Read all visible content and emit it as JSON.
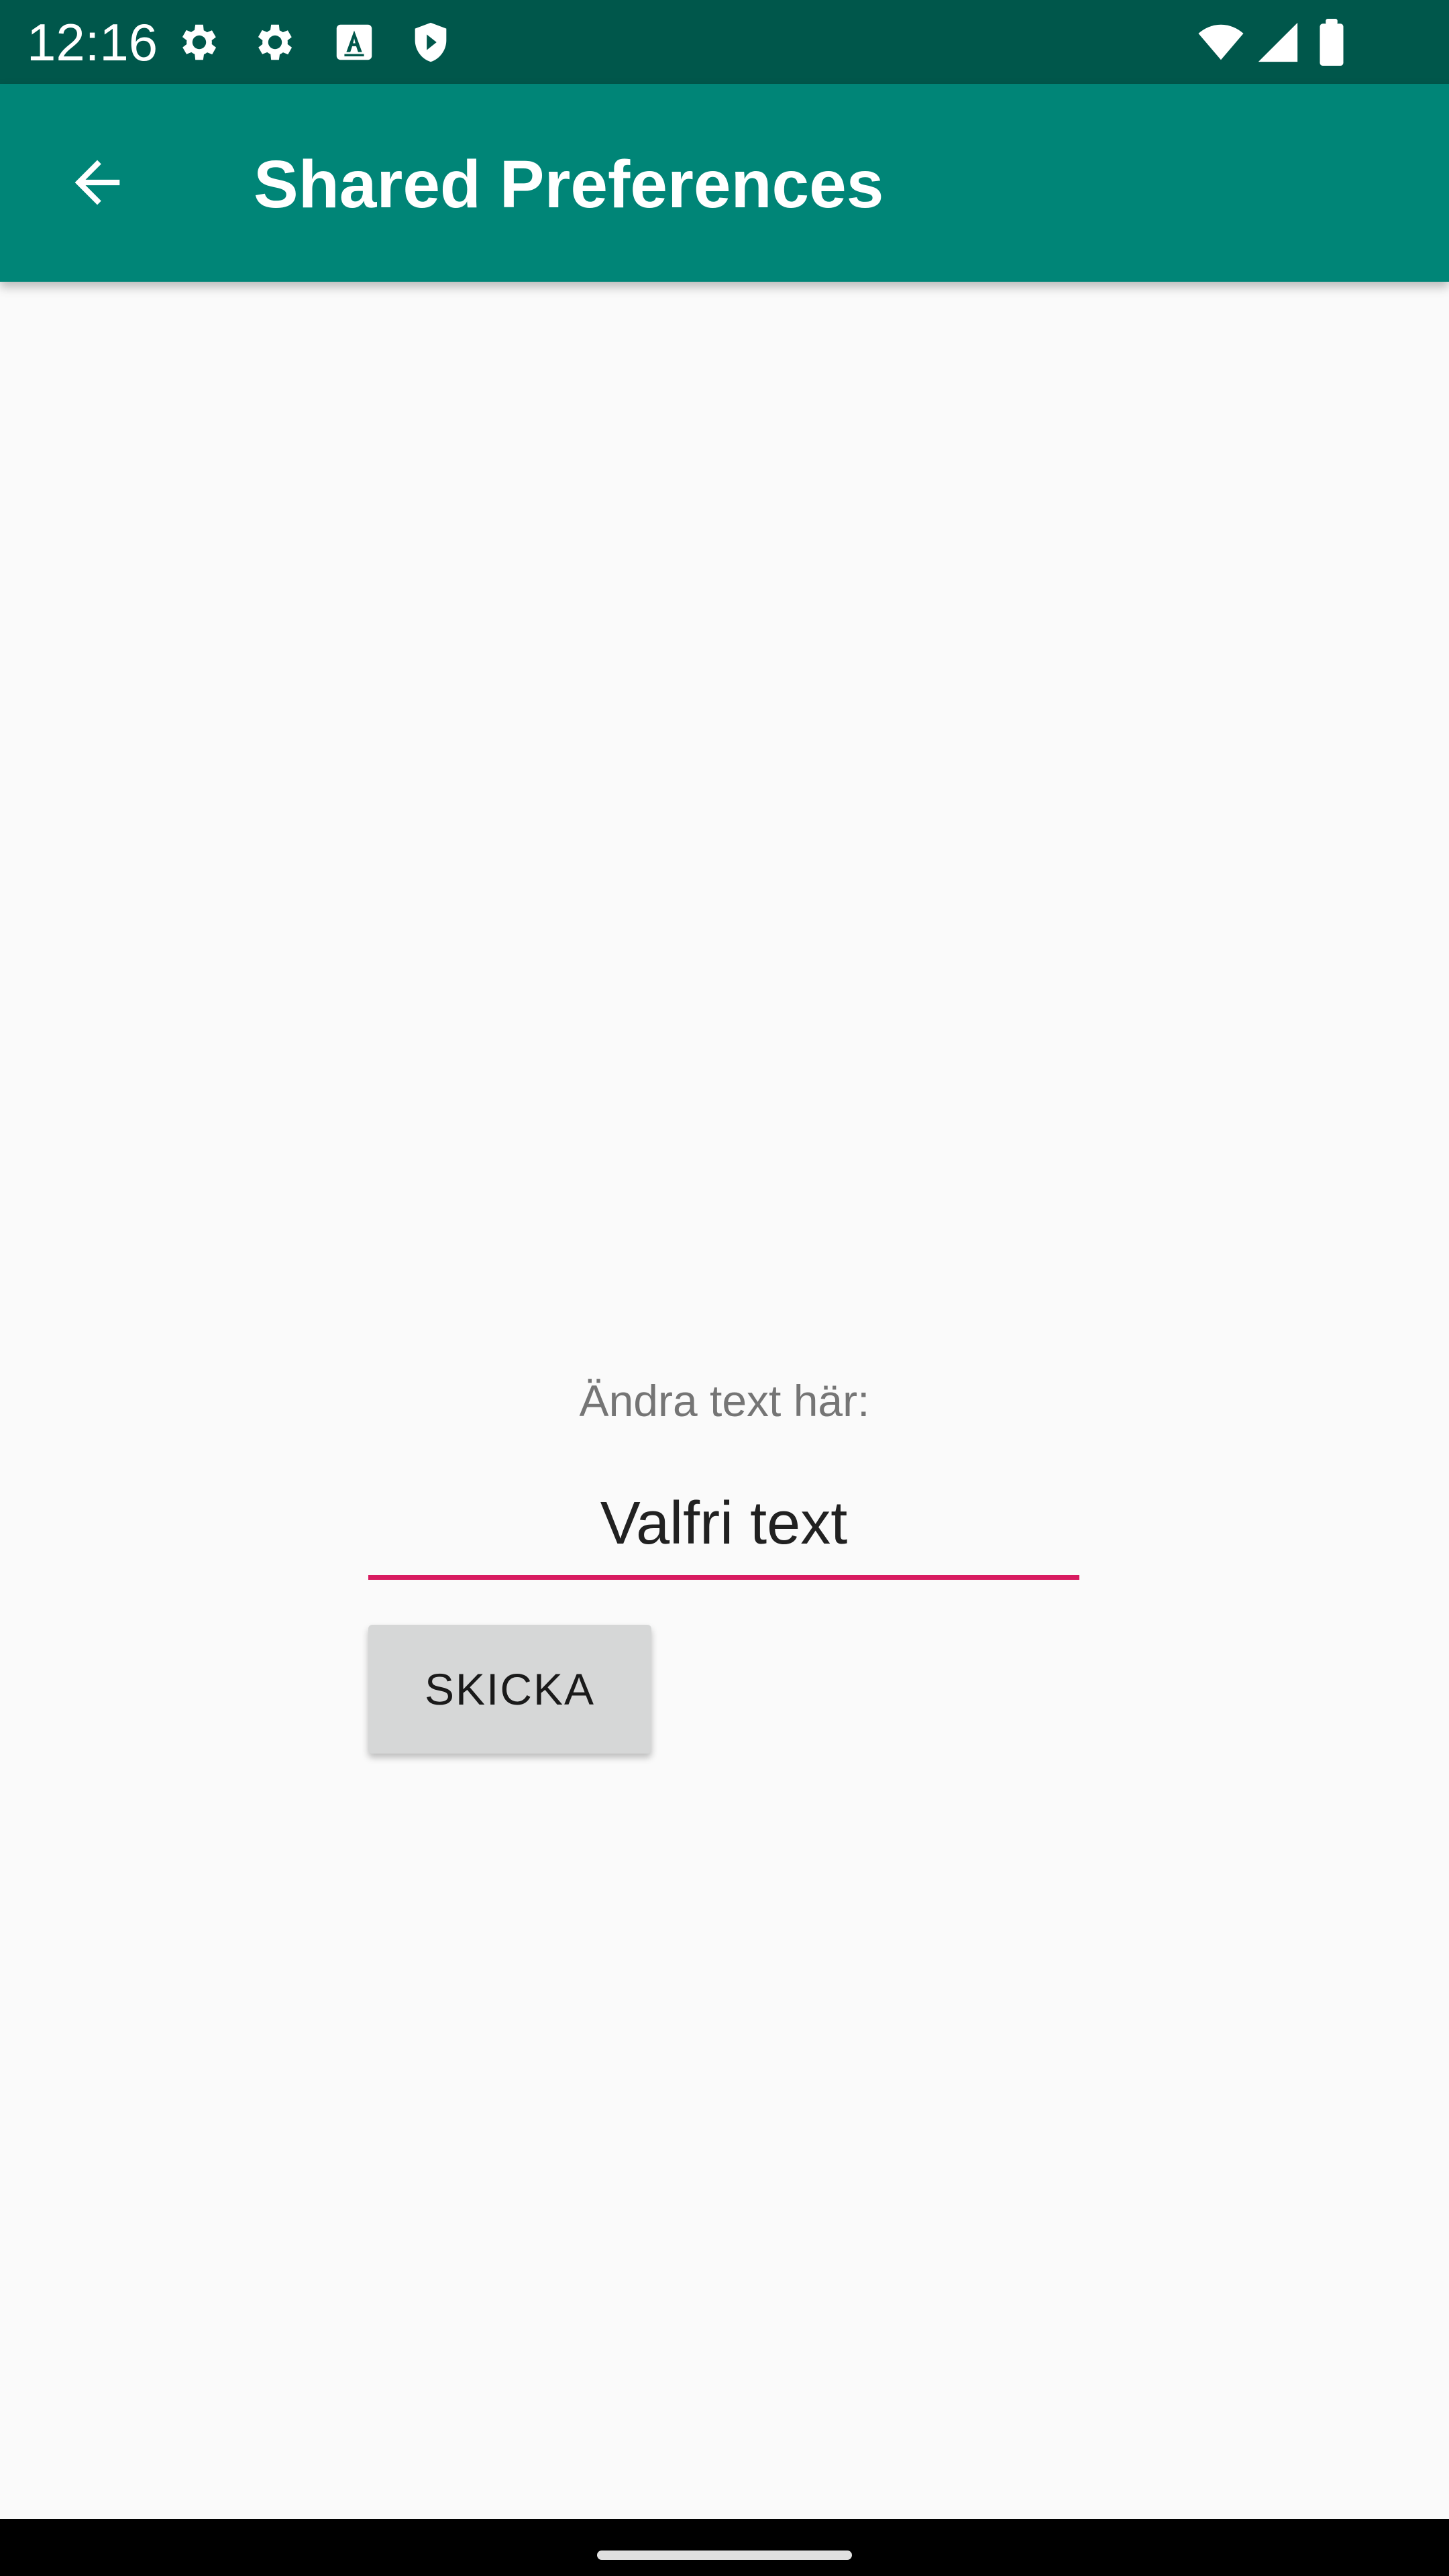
{
  "status_bar": {
    "time": "12:16",
    "icons": [
      "settings-icon",
      "settings-icon",
      "text-a-icon",
      "shield-icon",
      "wifi-icon",
      "signal-icon",
      "battery-icon"
    ]
  },
  "app_bar": {
    "title": "Shared Preferences",
    "back_icon": "arrow-back-icon"
  },
  "form": {
    "label": "Ändra text här:",
    "input_value": "Valfri text",
    "button_label": "SKICKA"
  },
  "colors": {
    "status_bar": "#00574b",
    "app_bar": "#008577",
    "accent": "#d81b60",
    "background": "#fafafa",
    "button": "#d6d7d7"
  }
}
